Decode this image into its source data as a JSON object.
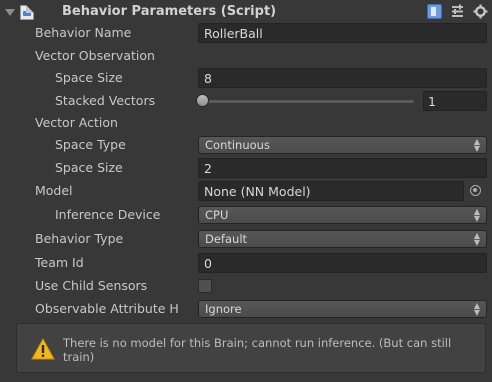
{
  "header": {
    "title": "Behavior Parameters (Script)"
  },
  "fields": {
    "behavior_name": {
      "label": "Behavior Name",
      "value": "RollerBall"
    },
    "vector_observation": {
      "label": "Vector Observation"
    },
    "space_size_obs": {
      "label": "Space Size",
      "value": "8"
    },
    "stacked_vectors": {
      "label": "Stacked Vectors",
      "value": "1",
      "slider_fraction": 0.0
    },
    "vector_action": {
      "label": "Vector Action"
    },
    "space_type": {
      "label": "Space Type",
      "value": "Continuous"
    },
    "space_size_act": {
      "label": "Space Size",
      "value": "2"
    },
    "model": {
      "label": "Model",
      "value": "None (NN Model)"
    },
    "inference_device": {
      "label": "Inference Device",
      "value": "CPU"
    },
    "behavior_type": {
      "label": "Behavior Type",
      "value": "Default"
    },
    "team_id": {
      "label": "Team Id",
      "value": "0"
    },
    "use_child_sensors": {
      "label": "Use Child Sensors",
      "checked": false
    },
    "observable_attribute": {
      "label": "Observable Attribute H",
      "value": "Ignore"
    }
  },
  "help": {
    "message": "There is no model for this Brain; cannot run inference. (But can still train)"
  },
  "colors": {
    "background": "#383838",
    "field": "#2a2a2a",
    "warning": "#f2b81c"
  }
}
